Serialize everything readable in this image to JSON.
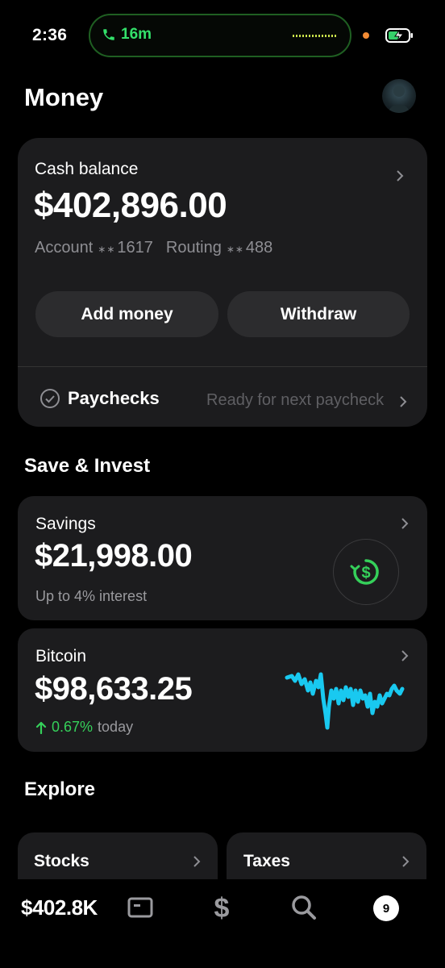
{
  "status_bar": {
    "time": "2:36",
    "call_duration": "16m"
  },
  "header": {
    "title": "Money"
  },
  "cash": {
    "label": "Cash balance",
    "amount": "$402,896.00",
    "account_label": "Account",
    "account_mask": "∗∗",
    "account_last": "1617",
    "routing_label": "Routing",
    "routing_mask": "∗∗",
    "routing_last": "488",
    "add_money": "Add money",
    "withdraw": "Withdraw",
    "paychecks_label": "Paychecks",
    "paychecks_status": "Ready for next paycheck"
  },
  "save_invest": {
    "section_title": "Save & Invest",
    "savings": {
      "label": "Savings",
      "amount": "$21,998.00",
      "subtitle": "Up to 4% interest"
    },
    "bitcoin": {
      "label": "Bitcoin",
      "amount": "$98,633.25",
      "change": "0.67%",
      "period": "today"
    }
  },
  "explore": {
    "section_title": "Explore",
    "tiles": [
      {
        "label": "Stocks"
      },
      {
        "label": "Taxes"
      }
    ]
  },
  "bottom_nav": {
    "balance": "$402.8K",
    "notification_count": "9"
  },
  "colors": {
    "accent_green": "#35d05a",
    "sparkline": "#19c9f0",
    "card_bg": "#1c1c1e"
  },
  "icons": [
    "phone-icon",
    "battery-charging-icon",
    "chevron-right-icon",
    "check-circle-icon",
    "dollar-circle-icon",
    "arrow-up-icon",
    "card-icon",
    "dollar-icon",
    "search-icon"
  ]
}
